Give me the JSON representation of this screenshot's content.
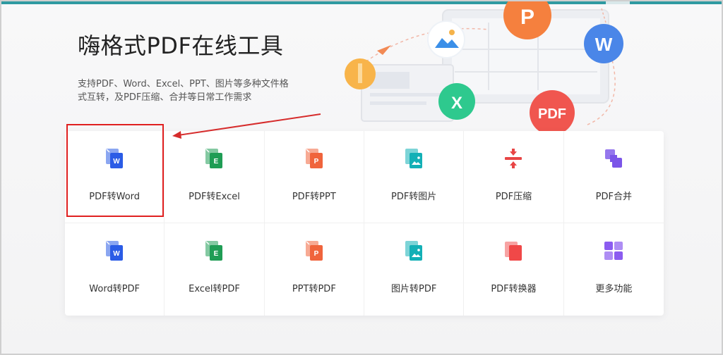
{
  "hero": {
    "title": "嗨格式PDF在线工具",
    "description": "支持PDF、Word、Excel、PPT、图片等多种文件格式互转，及PDF压缩、合并等日常工作需求"
  },
  "illustration": {
    "badges": [
      {
        "name": "ppt-badge",
        "text": "P",
        "color": "#f5803e"
      },
      {
        "name": "word-badge",
        "text": "W",
        "color": "#4a86e8"
      },
      {
        "name": "excel-badge",
        "text": "X",
        "color": "#2ec98e"
      },
      {
        "name": "pdf-badge",
        "text": "PDF",
        "color": "#f0564f"
      }
    ]
  },
  "tools": [
    {
      "label": "PDF转Word",
      "icon": "pdf-to-word-icon",
      "color": "#2b5ce6",
      "letter": "W"
    },
    {
      "label": "PDF转Excel",
      "icon": "pdf-to-excel-icon",
      "color": "#1f9d55",
      "letter": "E"
    },
    {
      "label": "PDF转PPT",
      "icon": "pdf-to-ppt-icon",
      "color": "#f0643c",
      "letter": "P"
    },
    {
      "label": "PDF转图片",
      "icon": "pdf-to-image-icon",
      "color": "#13b0b6",
      "letter": ""
    },
    {
      "label": "PDF压缩",
      "icon": "pdf-compress-icon",
      "color": "#e84545",
      "letter": ""
    },
    {
      "label": "PDF合并",
      "icon": "pdf-merge-icon",
      "color": "#7b55e8",
      "letter": ""
    },
    {
      "label": "Word转PDF",
      "icon": "word-to-pdf-icon",
      "color": "#2b5ce6",
      "letter": "W"
    },
    {
      "label": "Excel转PDF",
      "icon": "excel-to-pdf-icon",
      "color": "#1f9d55",
      "letter": "E"
    },
    {
      "label": "PPT转PDF",
      "icon": "ppt-to-pdf-icon",
      "color": "#f0643c",
      "letter": "P"
    },
    {
      "label": "图片转PDF",
      "icon": "image-to-pdf-icon",
      "color": "#13b0b6",
      "letter": ""
    },
    {
      "label": "PDF转换器",
      "icon": "pdf-converter-icon",
      "color": "#f04848",
      "letter": ""
    },
    {
      "label": "更多功能",
      "icon": "more-functions-icon",
      "color": "#8b5cf0",
      "letter": ""
    }
  ],
  "annotation": {
    "highlight_color": "#e02020"
  }
}
